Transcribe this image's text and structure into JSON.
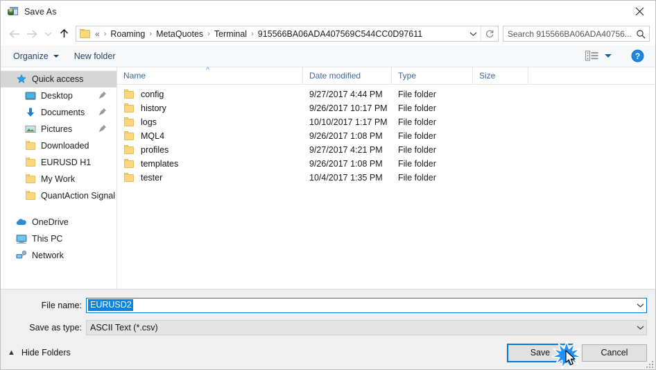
{
  "window": {
    "title": "Save As",
    "icon": "save-as-app-icon",
    "close_icon": "close-icon"
  },
  "nav": {
    "back_icon": "back-arrow-icon",
    "forward_icon": "forward-arrow-icon",
    "recent_icon": "recent-locations-chevron-icon",
    "up_icon": "up-arrow-icon",
    "address_folder_icon": "folder-icon",
    "breadcrumb_overflow": "«",
    "breadcrumbs": [
      "Roaming",
      "MetaQuotes",
      "Terminal",
      "915566BA06ADA407569C544CC0D97611"
    ],
    "separator": "›",
    "dropdown_icon": "chevron-down-icon",
    "refresh_icon": "refresh-icon"
  },
  "search": {
    "placeholder": "Search 915566BA06ADA40756...",
    "value": "",
    "icon": "search-icon"
  },
  "toolbar": {
    "organize_label": "Organize",
    "new_folder_label": "New folder",
    "view_icon": "view-layout-icon",
    "view_caret_icon": "chevron-down-icon",
    "help_icon": "help-icon",
    "help_label": "?"
  },
  "sidebar": {
    "items": [
      {
        "label": "Quick access",
        "icon": "star-pin-icon",
        "selected": true,
        "level": 1,
        "pinned": false
      },
      {
        "label": "Desktop",
        "icon": "desktop-icon",
        "selected": false,
        "level": 2,
        "pinned": true
      },
      {
        "label": "Documents",
        "icon": "documents-arrow-icon",
        "selected": false,
        "level": 2,
        "pinned": true
      },
      {
        "label": "Pictures",
        "icon": "pictures-icon",
        "selected": false,
        "level": 2,
        "pinned": true
      },
      {
        "label": "Downloaded",
        "icon": "folder-icon",
        "selected": false,
        "level": 2,
        "pinned": false
      },
      {
        "label": "EURUSD H1",
        "icon": "folder-icon",
        "selected": false,
        "level": 2,
        "pinned": false
      },
      {
        "label": "My Work",
        "icon": "folder-icon",
        "selected": false,
        "level": 2,
        "pinned": false
      },
      {
        "label": "QuantAction Signal",
        "icon": "folder-icon",
        "selected": false,
        "level": 2,
        "pinned": false
      },
      {
        "label": "OneDrive",
        "icon": "onedrive-cloud-icon",
        "selected": false,
        "level": 1,
        "pinned": false
      },
      {
        "label": "This PC",
        "icon": "this-pc-icon",
        "selected": false,
        "level": 1,
        "pinned": false
      },
      {
        "label": "Network",
        "icon": "network-icon",
        "selected": false,
        "level": 1,
        "pinned": false
      }
    ]
  },
  "filelist": {
    "columns": [
      "Name",
      "Date modified",
      "Type",
      "Size"
    ],
    "sort_column": "Name",
    "sort_caret_icon": "sort-ascending-icon",
    "rows": [
      {
        "name": "config",
        "date": "9/27/2017 4:44 PM",
        "type": "File folder",
        "size": "",
        "icon": "folder-icon"
      },
      {
        "name": "history",
        "date": "9/26/2017 10:17 PM",
        "type": "File folder",
        "size": "",
        "icon": "folder-icon"
      },
      {
        "name": "logs",
        "date": "10/10/2017 1:17 PM",
        "type": "File folder",
        "size": "",
        "icon": "folder-icon"
      },
      {
        "name": "MQL4",
        "date": "9/26/2017 1:08 PM",
        "type": "File folder",
        "size": "",
        "icon": "folder-icon"
      },
      {
        "name": "profiles",
        "date": "9/27/2017 4:21 PM",
        "type": "File folder",
        "size": "",
        "icon": "folder-icon"
      },
      {
        "name": "templates",
        "date": "9/26/2017 1:08 PM",
        "type": "File folder",
        "size": "",
        "icon": "folder-icon"
      },
      {
        "name": "tester",
        "date": "10/4/2017 1:35 PM",
        "type": "File folder",
        "size": "",
        "icon": "folder-icon"
      }
    ]
  },
  "form": {
    "filename_label": "File name:",
    "filename_value": "EURUSD2",
    "filetype_label": "Save as type:",
    "filetype_value": "ASCII Text (*.csv)",
    "combo_caret_icon": "chevron-down-icon"
  },
  "actions": {
    "hide_folders_label": "Hide Folders",
    "hide_folders_caret_icon": "chevron-up-icon",
    "save_label": "Save",
    "cancel_label": "Cancel",
    "resize_grip_icon": "resize-grip-icon",
    "click_burst_icon": "click-burst-icon",
    "cursor_icon": "mouse-pointer-icon"
  },
  "colors": {
    "accent": "#0078d7",
    "selection": "#0a84e0",
    "folder": "#fcd77e",
    "toolbar_text": "#26415e",
    "column_header_text": "#3b6695"
  }
}
